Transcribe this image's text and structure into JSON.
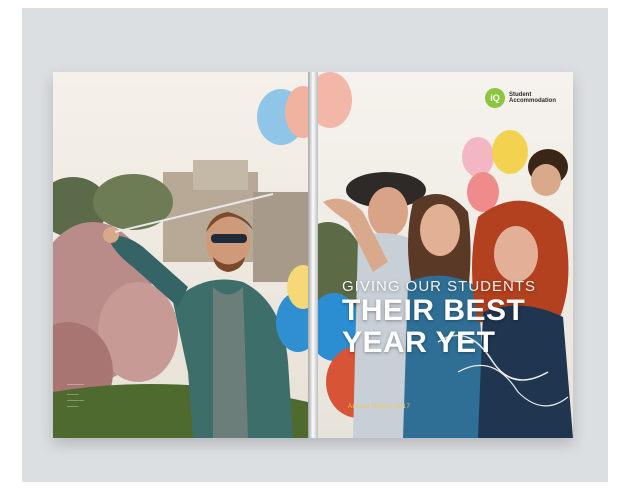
{
  "logo": {
    "badge": "iQ",
    "text": "Student Accommodation"
  },
  "cover": {
    "kicker": "GIVING OUR STUDENTS",
    "title_line1": "THEIR BEST",
    "title_line2": "YEAR YET",
    "report_tag": "Annual Report 2017"
  },
  "colors": {
    "logo_green": "#8cc63f",
    "background_frame": "#dcdfe2",
    "accent_yellow": "#f5c64a"
  }
}
